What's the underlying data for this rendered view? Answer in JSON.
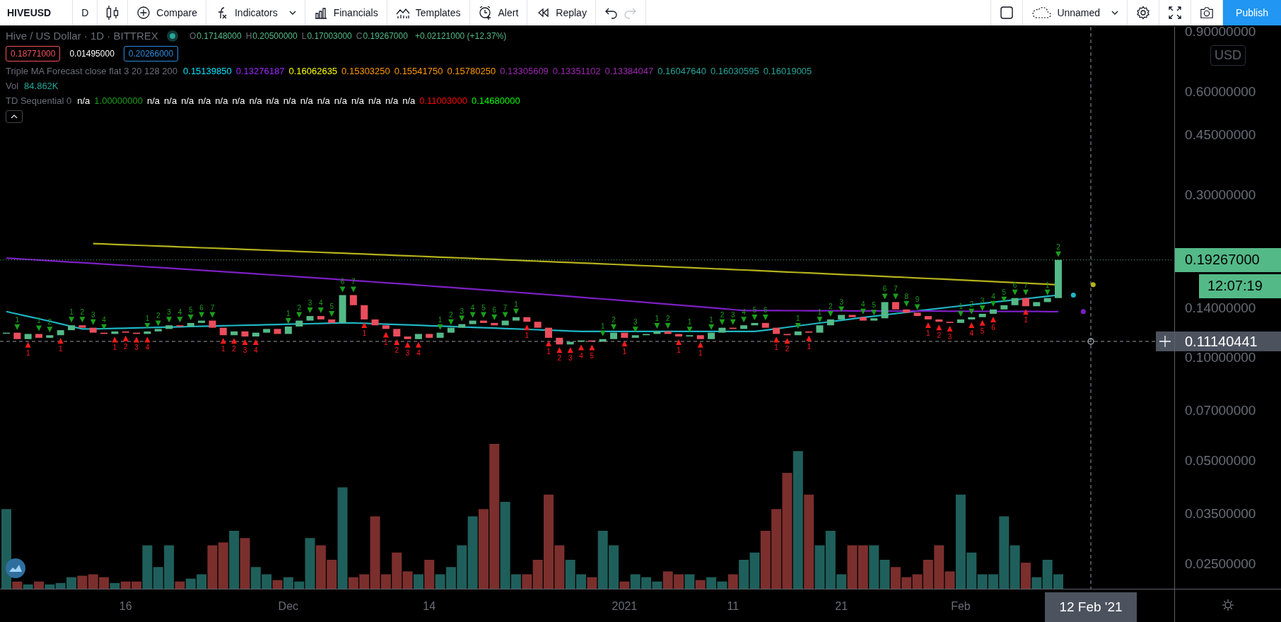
{
  "toolbar": {
    "symbol": "HIVEUSD",
    "interval": "D",
    "items": [
      {
        "kind": "compare",
        "label": "Compare"
      },
      {
        "kind": "indicators",
        "label": "Indicators"
      },
      {
        "kind": "financials",
        "label": "Financials"
      },
      {
        "kind": "templates",
        "label": "Templates"
      },
      {
        "kind": "alert",
        "label": "Alert"
      },
      {
        "kind": "replay",
        "label": "Replay"
      }
    ],
    "undo": {
      "disabled": false
    },
    "redo": {
      "disabled": true
    },
    "layout_name": "Unnamed",
    "publish": "Publish"
  },
  "legend": {
    "title": "Hive / US Dollar · 1D · BITTREX",
    "ohlc": [
      {
        "key": "O",
        "value": "0.17148000"
      },
      {
        "key": "H",
        "value": "0.20500000"
      },
      {
        "key": "L",
        "value": "0.17003000"
      },
      {
        "key": "C",
        "value": "0.19267000"
      }
    ],
    "change": "+0.02121000 (+12.37%)",
    "quotes": [
      {
        "kind": "bid",
        "value": "0.18771000"
      },
      {
        "kind": "spread",
        "value": "0.01495000"
      },
      {
        "kind": "ask",
        "value": "0.20266000"
      }
    ],
    "indicators": [
      {
        "name": "Triple MA Forecast close flat 3 20 128 200",
        "values": [
          {
            "text": "0.15139850",
            "color": "#00e5ff"
          },
          {
            "text": "0.13276187",
            "color": "#9c27ff"
          },
          {
            "text": "0.16062635",
            "color": "#ffff00"
          },
          {
            "text": "0.15303250",
            "color": "#ff9800"
          },
          {
            "text": "0.15541750",
            "color": "#ff9800"
          },
          {
            "text": "0.15780250",
            "color": "#ff9800"
          },
          {
            "text": "0.13305609",
            "color": "#9c27b0"
          },
          {
            "text": "0.13351102",
            "color": "#9c27b0"
          },
          {
            "text": "0.13384047",
            "color": "#9c27b0"
          },
          {
            "text": "0.16047640",
            "color": "#26a69a"
          },
          {
            "text": "0.16030595",
            "color": "#26a69a"
          },
          {
            "text": "0.16019005",
            "color": "#26a69a"
          }
        ]
      },
      {
        "name": "Vol",
        "values": [
          {
            "text": "84.862K",
            "color": "#26a69a"
          }
        ]
      },
      {
        "name": "TD Sequential 0",
        "values": [
          {
            "text": "n/a",
            "color": "#ffffff"
          },
          {
            "text": "1.00000000",
            "color": "#1b9e1b"
          },
          {
            "text": "n/a",
            "color": "#ffffff"
          },
          {
            "text": "n/a",
            "color": "#ffffff"
          },
          {
            "text": "n/a",
            "color": "#ffffff"
          },
          {
            "text": "n/a",
            "color": "#ffffff"
          },
          {
            "text": "n/a",
            "color": "#ffffff"
          },
          {
            "text": "n/a",
            "color": "#ffffff"
          },
          {
            "text": "n/a",
            "color": "#ffffff"
          },
          {
            "text": "n/a",
            "color": "#ffffff"
          },
          {
            "text": "n/a",
            "color": "#ffffff"
          },
          {
            "text": "n/a",
            "color": "#ffffff"
          },
          {
            "text": "n/a",
            "color": "#ffffff"
          },
          {
            "text": "n/a",
            "color": "#ffffff"
          },
          {
            "text": "n/a",
            "color": "#ffffff"
          },
          {
            "text": "n/a",
            "color": "#ffffff"
          },
          {
            "text": "n/a",
            "color": "#ffffff"
          },
          {
            "text": "n/a",
            "color": "#ffffff"
          },
          {
            "text": "0.11003000",
            "color": "#ff0000"
          },
          {
            "text": "0.14680000",
            "color": "#00ff00"
          }
        ]
      }
    ]
  },
  "chart": {
    "price_ticks": [
      "0.90000000",
      "0.60000000",
      "0.45000000",
      "0.30000000",
      "0.14000000",
      "0.10000000",
      "0.07000000",
      "0.05000000",
      "0.03500000",
      "0.02500000"
    ],
    "time_ticks": [
      "16",
      "Dec",
      "14",
      "2021",
      "11",
      "21",
      "Feb"
    ],
    "td_counts": [
      {
        "text": "1",
        "kind": "sell"
      },
      {
        "text": "1",
        "kind": "sell"
      },
      {
        "text": "2",
        "kind": "sell"
      },
      {
        "text": "1",
        "kind": "sell"
      },
      {
        "text": "2",
        "kind": "sell"
      },
      {
        "text": "3",
        "kind": "sell"
      },
      {
        "text": "4",
        "kind": "sell"
      },
      {
        "text": "1",
        "kind": "sell"
      },
      {
        "text": "2",
        "kind": "sell"
      },
      {
        "text": "3",
        "kind": "sell"
      },
      {
        "text": "4",
        "kind": "sell"
      },
      {
        "text": "5",
        "kind": "sell"
      },
      {
        "text": "6",
        "kind": "sell"
      },
      {
        "text": "7",
        "kind": "sell"
      },
      {
        "text": "1",
        "kind": "sell"
      },
      {
        "text": "2",
        "kind": "sell"
      },
      {
        "text": "3",
        "kind": "sell"
      },
      {
        "text": "4",
        "kind": "sell"
      },
      {
        "text": "5",
        "kind": "sell"
      },
      {
        "text": "6",
        "kind": "sell"
      },
      {
        "text": "7",
        "kind": "sell"
      },
      {
        "text": "1",
        "kind": "sell"
      },
      {
        "text": "2",
        "kind": "sell"
      },
      {
        "text": "3",
        "kind": "sell"
      },
      {
        "text": "4",
        "kind": "sell"
      },
      {
        "text": "5",
        "kind": "sell"
      },
      {
        "text": "6",
        "kind": "sell"
      },
      {
        "text": "7",
        "kind": "sell"
      },
      {
        "text": "1",
        "kind": "sell"
      },
      {
        "text": "1",
        "kind": "sell"
      },
      {
        "text": "2",
        "kind": "sell"
      },
      {
        "text": "3",
        "kind": "sell"
      },
      {
        "text": "1",
        "kind": "sell"
      },
      {
        "text": "2",
        "kind": "sell"
      },
      {
        "text": "1",
        "kind": "sell"
      },
      {
        "text": "1",
        "kind": "sell"
      },
      {
        "text": "2",
        "kind": "sell"
      },
      {
        "text": "3",
        "kind": "sell"
      },
      {
        "text": "4",
        "kind": "sell"
      },
      {
        "text": "5",
        "kind": "sell"
      },
      {
        "text": "6",
        "kind": "sell"
      },
      {
        "text": "1",
        "kind": "sell"
      },
      {
        "text": "1",
        "kind": "sell"
      },
      {
        "text": "2",
        "kind": "sell"
      },
      {
        "text": "3",
        "kind": "sell"
      },
      {
        "text": "4",
        "kind": "sell"
      },
      {
        "text": "5",
        "kind": "sell"
      },
      {
        "text": "6",
        "kind": "sell"
      },
      {
        "text": "7",
        "kind": "sell"
      },
      {
        "text": "8",
        "kind": "sell"
      },
      {
        "text": "9",
        "kind": "sell"
      },
      {
        "text": "1",
        "kind": "sell"
      },
      {
        "text": "2",
        "kind": "sell"
      },
      {
        "text": "3",
        "kind": "sell"
      },
      {
        "text": "4",
        "kind": "sell"
      },
      {
        "text": "5",
        "kind": "sell"
      },
      {
        "text": "6",
        "kind": "sell"
      },
      {
        "text": "7",
        "kind": "sell"
      },
      {
        "text": "1",
        "kind": "sell"
      },
      {
        "text": "2",
        "kind": "sell"
      },
      {
        "text": "1",
        "kind": "buy"
      },
      {
        "text": "1",
        "kind": "buy"
      },
      {
        "text": "1",
        "kind": "buy"
      },
      {
        "text": "2",
        "kind": "buy"
      },
      {
        "text": "3",
        "kind": "buy"
      },
      {
        "text": "4",
        "kind": "buy"
      },
      {
        "text": "1",
        "kind": "buy"
      },
      {
        "text": "2",
        "kind": "buy"
      },
      {
        "text": "3",
        "kind": "buy"
      },
      {
        "text": "4",
        "kind": "buy"
      },
      {
        "text": "1",
        "kind": "buy"
      },
      {
        "text": "1",
        "kind": "buy"
      },
      {
        "text": "2",
        "kind": "buy"
      },
      {
        "text": "3",
        "kind": "buy"
      },
      {
        "text": "4",
        "kind": "buy"
      },
      {
        "text": "1",
        "kind": "buy"
      },
      {
        "text": "1",
        "kind": "buy"
      },
      {
        "text": "2",
        "kind": "buy"
      },
      {
        "text": "3",
        "kind": "buy"
      },
      {
        "text": "4",
        "kind": "buy"
      },
      {
        "text": "5",
        "kind": "buy"
      },
      {
        "text": "1",
        "kind": "buy"
      },
      {
        "text": "1",
        "kind": "buy"
      },
      {
        "text": "1",
        "kind": "buy"
      },
      {
        "text": "1",
        "kind": "buy"
      },
      {
        "text": "2",
        "kind": "buy"
      },
      {
        "text": "1",
        "kind": "buy"
      },
      {
        "text": "1",
        "kind": "buy"
      },
      {
        "text": "2",
        "kind": "buy"
      },
      {
        "text": "3",
        "kind": "buy"
      },
      {
        "text": "4",
        "kind": "buy"
      },
      {
        "text": "5",
        "kind": "buy"
      },
      {
        "text": "6",
        "kind": "buy"
      },
      {
        "text": "1",
        "kind": "buy"
      }
    ]
  },
  "price_axis": {
    "currency": "USD",
    "last_price": "0.19267000",
    "countdown": "12:07:19",
    "crosshair_price": "0.11140441"
  },
  "time_axis": {
    "crosshair_time": "12 Feb '21"
  }
}
